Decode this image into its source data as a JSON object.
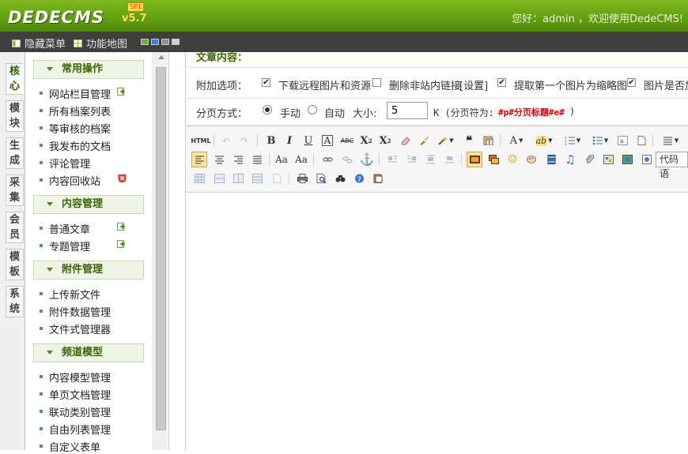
{
  "header": {
    "logo": "DEDECMS",
    "version": "v5.7",
    "sp": "SP1",
    "welcome": "您好：admin ，欢迎使用DedeCMS!"
  },
  "toolbar": {
    "hide_menu": "隐藏菜单",
    "site_map": "功能地图",
    "swatches": [
      "#6fae2a",
      "#3b7fd4",
      "#8f8f8f",
      "#cfcfcf"
    ]
  },
  "vtabs": [
    {
      "label": "核心"
    },
    {
      "label": "模块"
    },
    {
      "label": "生成"
    },
    {
      "label": "采集"
    },
    {
      "label": "会员"
    },
    {
      "label": "模板"
    },
    {
      "label": "系统"
    }
  ],
  "sidebar": {
    "sections": [
      {
        "title": "常用操作",
        "items": [
          "网站栏目管理",
          "所有档案列表",
          "等审核的档案",
          "我发布的文档",
          "评论管理",
          "内容回收站"
        ]
      },
      {
        "title": "内容管理",
        "items": [
          "普通文章",
          "专题管理"
        ]
      },
      {
        "title": "附件管理",
        "items": [
          "上传新文件",
          "附件数据管理",
          "文件式管理器"
        ]
      },
      {
        "title": "频道模型",
        "items": [
          "内容模型管理",
          "单页文档管理",
          "联动类别管理",
          "自由列表管理",
          "自定义表单"
        ]
      }
    ]
  },
  "main": {
    "content_title": "文章内容：",
    "extra": {
      "label": "附加选项：",
      "opt1": "下载远程图片和资源",
      "opt2": "删除非站内链接",
      "opt2_link": "[设置]",
      "opt3": "提取第一个图片为缩略图",
      "opt4": "图片是否加"
    },
    "paging": {
      "label": "分页方式：",
      "manual": "手动",
      "auto": "自动",
      "size_label": "大小:",
      "size_value": "5",
      "unit": "K (分页符为:",
      "marker": "#p#分页标题#e#",
      "close": ")"
    },
    "editor": {
      "html_label": "HTML",
      "bold": "B",
      "italic": "I",
      "underline": "U",
      "strike": "ABC",
      "font_combo": "代码语"
    }
  }
}
